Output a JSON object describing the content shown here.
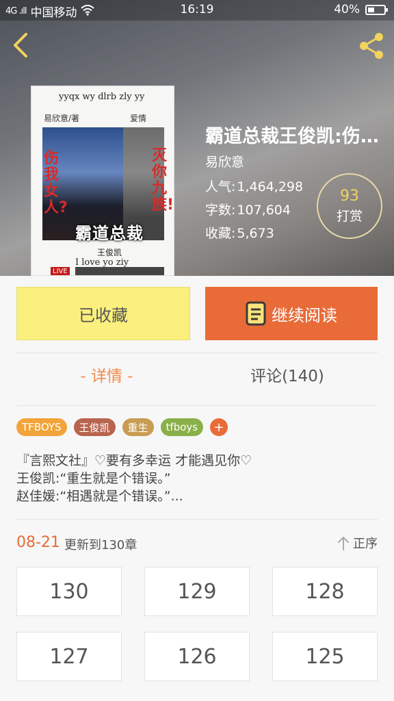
{
  "status_bar": {
    "signal": "4G .ıll",
    "carrier": "中国移动",
    "time": "16:19",
    "battery": "40%"
  },
  "cover": {
    "top_text": "yyqx  wy  dlrb  zly  yy",
    "author_text": "易欣意/著",
    "love_text": "爱情",
    "title_text": "霸道总裁",
    "red_text_left": "伤我女人?",
    "red_text_right": "灭你九族!",
    "name_text": "王俊凯",
    "sub_text": "I love yo    ziy",
    "live_text": "LIVE"
  },
  "book": {
    "title": "霸道总裁王俊凯:伤我女人?灭你九族!",
    "author": "易欣意",
    "popularity_label": "人气:",
    "popularity": "1,464,298",
    "wordcount_label": "字数:",
    "wordcount": "107,604",
    "favorites_label": "收藏:",
    "favorites": "5,673"
  },
  "tip": {
    "count": "93",
    "label": "打赏"
  },
  "actions": {
    "favorite_label": "已收藏",
    "read_label": "继续阅读"
  },
  "tabs": {
    "detail": "- 详情 -",
    "comments": "评论(140)"
  },
  "tags": [
    {
      "label": "TFBOYS",
      "color": "#f2a43a"
    },
    {
      "label": "王俊凯",
      "color": "#b8644f"
    },
    {
      "label": "重生",
      "color": "#c89c52"
    },
    {
      "label": "tfboys",
      "color": "#8ab04a"
    }
  ],
  "tag_add": "+",
  "description": [
    "『言熙文社』♡要有多幸运  才能遇见你♡",
    "王俊凯:“重生就是个错误。”",
    "赵佳媛:“相遇就是个错误。”..."
  ],
  "update": {
    "date": "08-21",
    "text": "更新到130章",
    "order_label": "正序"
  },
  "chapters": [
    "130",
    "129",
    "128",
    "127",
    "126",
    "125"
  ]
}
